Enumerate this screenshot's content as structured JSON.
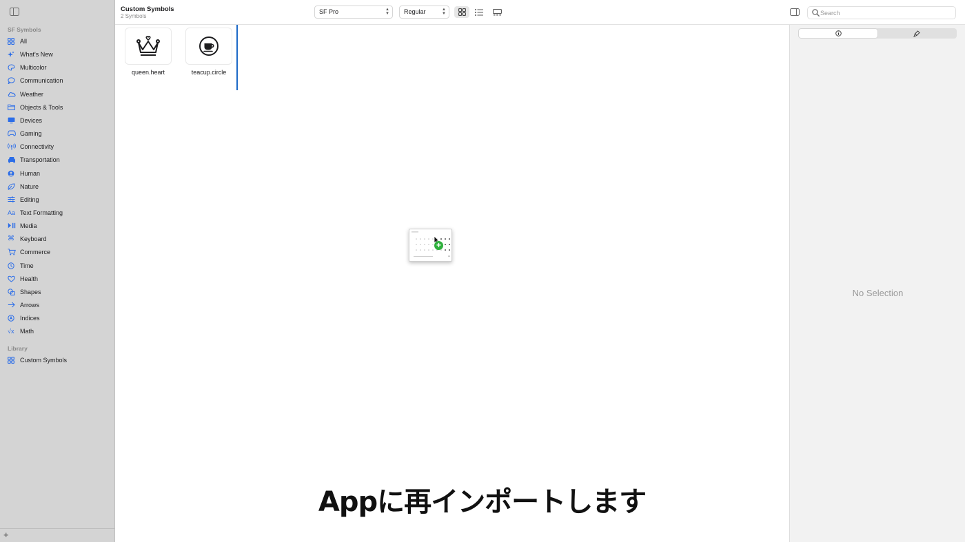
{
  "sidebar": {
    "section_symbols": "SF Symbols",
    "items": [
      {
        "label": "All",
        "icon": "grid-icon"
      },
      {
        "label": "What's New",
        "icon": "sparkle-icon"
      },
      {
        "label": "Multicolor",
        "icon": "palette-icon"
      },
      {
        "label": "Communication",
        "icon": "speech-bubble-icon"
      },
      {
        "label": "Weather",
        "icon": "cloud-icon"
      },
      {
        "label": "Objects & Tools",
        "icon": "folder-icon"
      },
      {
        "label": "Devices",
        "icon": "display-icon"
      },
      {
        "label": "Gaming",
        "icon": "game-controller-icon"
      },
      {
        "label": "Connectivity",
        "icon": "antenna-icon"
      },
      {
        "label": "Transportation",
        "icon": "car-icon"
      },
      {
        "label": "Human",
        "icon": "person-circle-icon"
      },
      {
        "label": "Nature",
        "icon": "leaf-icon"
      },
      {
        "label": "Editing",
        "icon": "sliders-icon"
      },
      {
        "label": "Text Formatting",
        "icon": "text-format-icon"
      },
      {
        "label": "Media",
        "icon": "play-pause-icon"
      },
      {
        "label": "Keyboard",
        "icon": "command-icon"
      },
      {
        "label": "Commerce",
        "icon": "cart-icon"
      },
      {
        "label": "Time",
        "icon": "clock-icon"
      },
      {
        "label": "Health",
        "icon": "heart-icon"
      },
      {
        "label": "Shapes",
        "icon": "shapes-icon"
      },
      {
        "label": "Arrows",
        "icon": "arrow-right-icon"
      },
      {
        "label": "Indices",
        "icon": "index-circle-icon"
      },
      {
        "label": "Math",
        "icon": "square-root-icon"
      }
    ],
    "section_library": "Library",
    "library_items": [
      {
        "label": "Custom Symbols",
        "icon": "grid-icon"
      }
    ],
    "add_label": "+"
  },
  "toolbar": {
    "title": "Custom Symbols",
    "subtitle": "2 Symbols",
    "font_select": "SF Pro",
    "weight_select": "Regular",
    "search_placeholder": "Search"
  },
  "symbols": [
    {
      "name": "queen.heart",
      "icon": "crown-icon"
    },
    {
      "name": "teacup.circle",
      "icon": "teacup-circle-icon"
    }
  ],
  "inspector": {
    "no_selection": "No Selection"
  },
  "caption": "Appに再インポートします",
  "colors": {
    "accent": "#2b6de8",
    "insertion_line": "#1c69c7",
    "plus_badge": "#2fb03d"
  }
}
